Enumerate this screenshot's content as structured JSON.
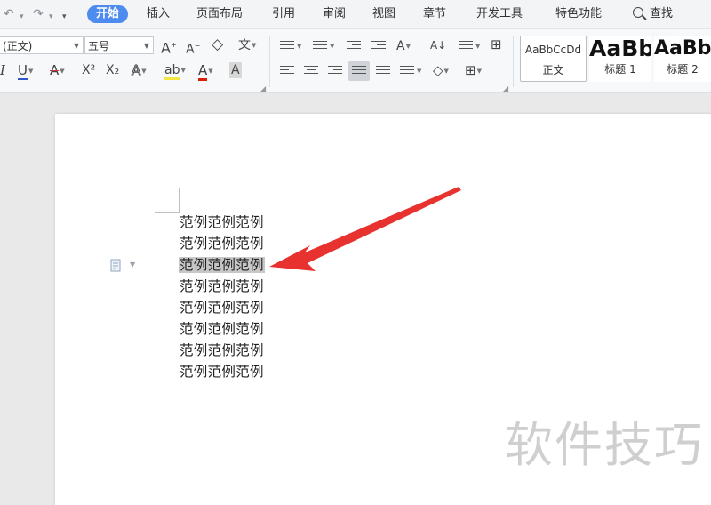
{
  "quick_access": {
    "undo": "↶",
    "undo_dd": "▾",
    "redo": "↷",
    "redo_dd": "▾",
    "customize": "▾"
  },
  "menu": {
    "tabs": [
      "开始",
      "插入",
      "页面布局",
      "引用",
      "审阅",
      "视图",
      "章节",
      "开发工具",
      "特色功能"
    ],
    "active_tab": "开始",
    "search_label": "查找"
  },
  "font": {
    "name": "(正文)",
    "size": "五号"
  },
  "toolbar": {
    "grow_font": "A",
    "shrink_font": "A",
    "clear_format": "◇",
    "phonetic": "文",
    "italic": "I",
    "underline": "U",
    "strike": "A",
    "superscript": "X²",
    "subscript": "X₂",
    "text_effect": "A",
    "highlight": "ab",
    "font_color": "A",
    "char_shading": "A",
    "sort": "A↓",
    "chinese_layout": "A"
  },
  "styles": [
    {
      "sample": "AaBbCcDd",
      "label": "正文"
    },
    {
      "sample": "AaBb",
      "label": "标题 1"
    },
    {
      "sample": "AaBb",
      "label": "标题 2"
    }
  ],
  "colors": {
    "accent": "#4e8bef",
    "underline_blue": "#3355cc",
    "strike_red": "#d23b3b",
    "highlight_yellow": "#f4e542",
    "font_color_red": "#d81e06",
    "selection_gray": "#c7c7c7",
    "arrow_red": "#e8322f"
  },
  "document": {
    "lines": [
      "范例范例范例",
      "范例范例范例",
      "范例范例范例",
      "范例范例范例",
      "范例范例范例",
      "范例范例范例",
      "范例范例范例",
      "范例范例范例"
    ],
    "highlighted_line_index": 2
  },
  "watermark": "软件技巧",
  "icons": [
    "undo-icon",
    "redo-icon",
    "search-icon",
    "eraser-icon",
    "bullets-icon",
    "numbering-icon",
    "outdent-icon",
    "indent-icon",
    "align-left-icon",
    "align-center-icon",
    "align-right-icon",
    "justify-icon",
    "distribute-icon",
    "line-spacing-icon",
    "shading-icon",
    "borders-icon",
    "table-icon",
    "paragraph-icon",
    "arrow-icon"
  ]
}
